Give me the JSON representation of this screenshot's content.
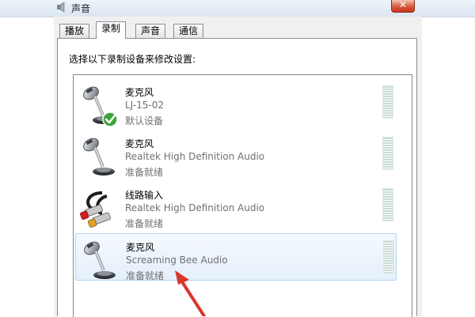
{
  "window": {
    "title": "声音",
    "close_glyph": "✕",
    "icon": "speaker-icon"
  },
  "tabs": [
    {
      "label": "播放",
      "active": false
    },
    {
      "label": "录制",
      "active": true
    },
    {
      "label": "声音",
      "active": false
    },
    {
      "label": "通信",
      "active": false
    }
  ],
  "instruction": "选择以下录制设备来修改设置:",
  "devices": [
    {
      "name": "麦克风",
      "description": "LJ-15-02",
      "status": "默认设备",
      "icon": "microphone-icon",
      "badge": "default-checkmark-icon",
      "selected": false
    },
    {
      "name": "麦克风",
      "description": "Realtek High Definition Audio",
      "status": "准备就绪",
      "icon": "microphone-icon",
      "selected": false
    },
    {
      "name": "线路输入",
      "description": "Realtek High Definition Audio",
      "status": "准备就绪",
      "icon": "line-in-cable-icon",
      "selected": false
    },
    {
      "name": "麦克风",
      "description": "Screaming Bee Audio",
      "status": "准备就绪",
      "icon": "microphone-icon",
      "selected": true
    }
  ],
  "colors": {
    "annotation_arrow": "#d9362b",
    "selection_border": "#b9d3ee",
    "checkmark_badge": "#3aa43a"
  }
}
